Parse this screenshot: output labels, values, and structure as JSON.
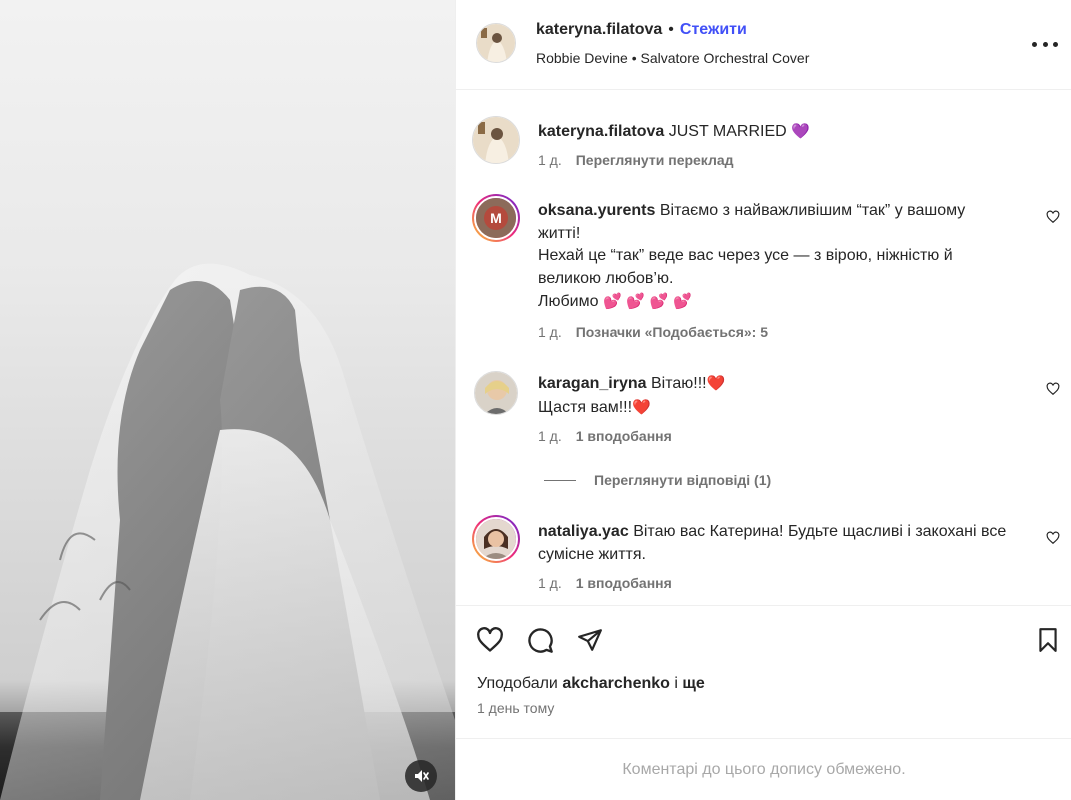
{
  "post": {
    "username": "kateryna.filatova",
    "follow_label": "Стежити",
    "bullet": "•",
    "music": "Robbie Devine • Salvatore Orchestral Cover",
    "more_icon": "more-horizontal-icon",
    "mute_icon": "speaker-muted-icon"
  },
  "caption": {
    "username": "kateryna.filatova",
    "text": "JUST MARRIED",
    "emoji": "💜",
    "age": "1 д.",
    "translate_label": "Переглянути переклад"
  },
  "comments": [
    {
      "username": "oksana.yurents",
      "line1": "Вітаємо з найважливішим “так” у вашому житті!",
      "line2": "Нехай це “так” веде вас через усе — з вірою, ніжністю й великою любов’ю.",
      "line3": "Любимо",
      "emojis": "💕 💕 💕 💕",
      "age": "1 д.",
      "likes_label": "Позначки «Подобається»: 5"
    },
    {
      "username": "karagan_iryna",
      "line1": "Вітаю!!!",
      "line1_emoji": "❤️",
      "line2": "Щастя вам!!!",
      "line2_emoji": "❤️",
      "age": "1 д.",
      "likes_label": "1 вподобання"
    },
    {
      "username": "nataliya.yac",
      "line1": "Вітаю вас Катерина! Будьте щасливі і закохані все сумісне життя.",
      "age": "1 д.",
      "likes_label": "1 вподобання"
    }
  ],
  "view_replies_label": "Переглянути відповіді (1)",
  "actions": {
    "like_icon": "heart-icon",
    "comment_icon": "comment-icon",
    "share_icon": "send-icon",
    "save_icon": "bookmark-icon"
  },
  "likes": {
    "prefix": "Уподобали",
    "user": "akcharchenko",
    "connector": "і",
    "suffix": "ще"
  },
  "time_ago": "1 день тому",
  "comments_restricted": "Коментарі до цього допису обмежено.",
  "colors": {
    "follow": "#4150f7",
    "muted_text": "#737373",
    "border": "#efefef"
  }
}
